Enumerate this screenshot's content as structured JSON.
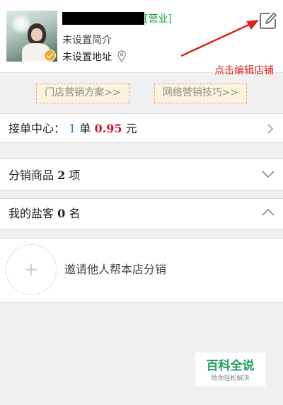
{
  "shop": {
    "status": "[营业]",
    "intro": "未设置简介",
    "address": "未设置地址"
  },
  "annotation": {
    "text": "点击编辑店铺",
    "color": "#e0211b"
  },
  "tips": {
    "store_marketing": "门店营销方案>>",
    "online_marketing": "网络营销技巧>>"
  },
  "order_center": {
    "label": "接单中心：",
    "count": "1",
    "unit": "单",
    "amount": "0.95",
    "currency": "元"
  },
  "distribution_goods": {
    "label": "分销商品",
    "count": "2",
    "unit": "项",
    "state": "collapsed"
  },
  "my_salt_customers": {
    "label": "我的盐客",
    "count": "0",
    "unit": "名",
    "state": "expanded"
  },
  "invite": {
    "plus": "+",
    "text": "邀请他人帮本店分销"
  },
  "watermark": {
    "title": "百科全说",
    "subtitle": "助你轻松解决"
  },
  "colors": {
    "status_green": "#1aa34a",
    "amount_red": "#d0112b",
    "count_blue": "#2c7fb8",
    "badge_orange": "#f5a623"
  },
  "icons": [
    "verified-check-icon",
    "location-pin-icon",
    "edit-icon",
    "chevron-right-icon",
    "chevron-down-icon",
    "chevron-up-icon"
  ]
}
